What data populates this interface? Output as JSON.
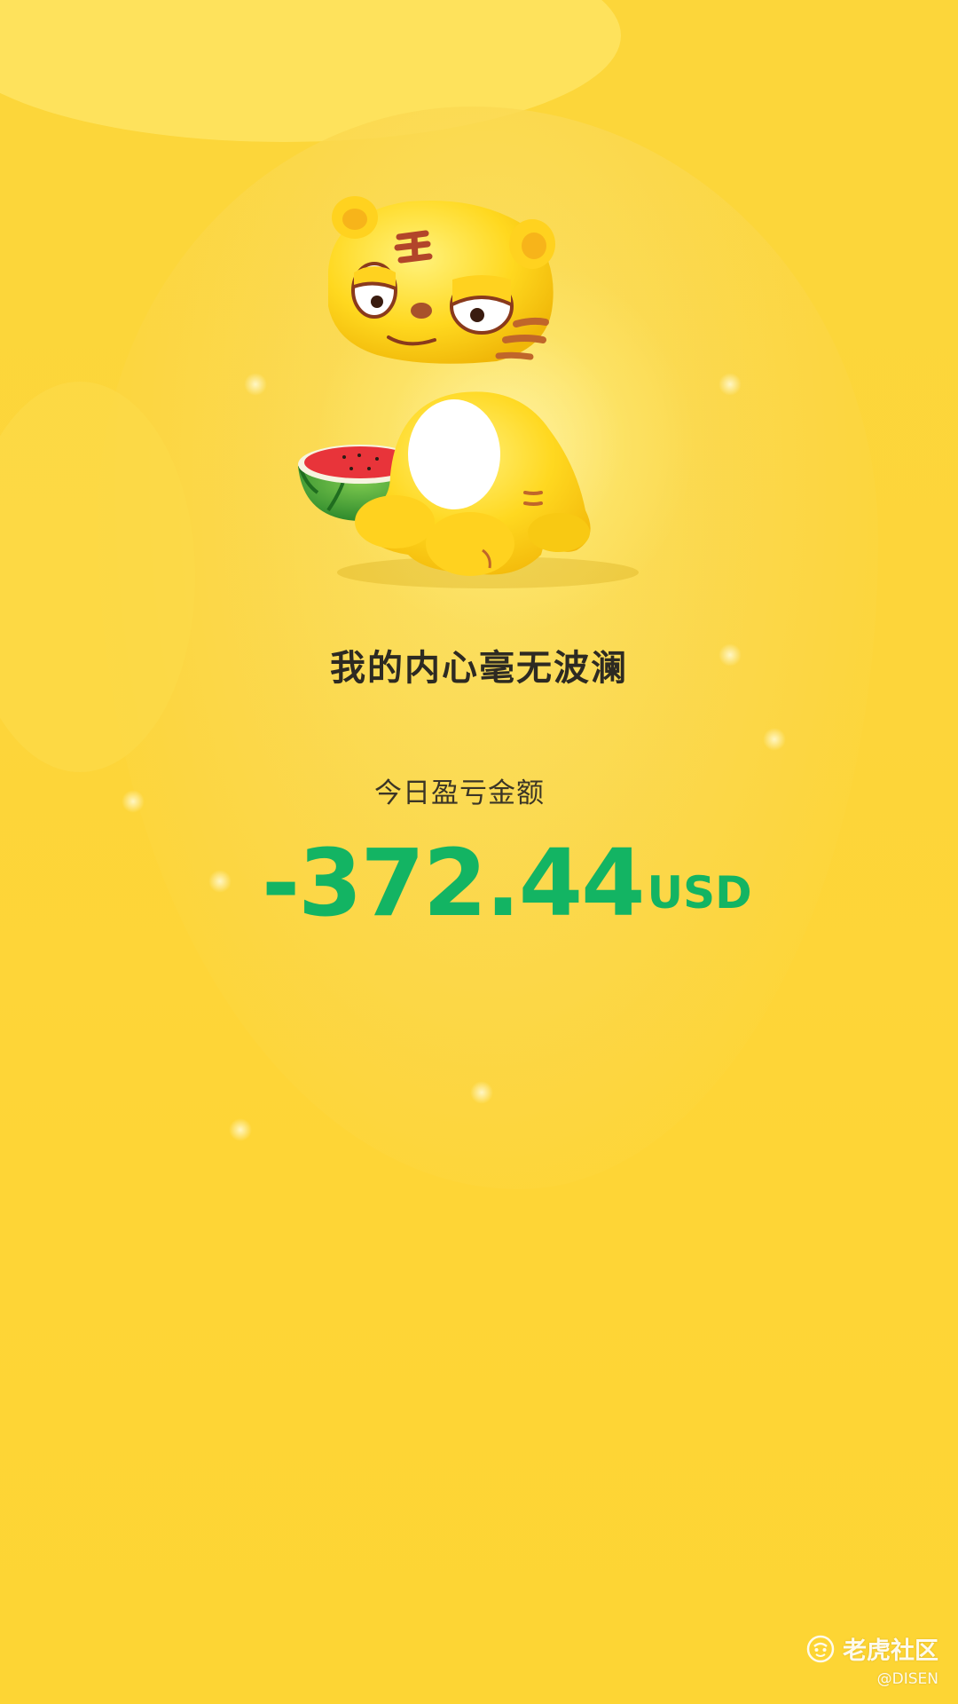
{
  "illustration": {
    "subject": "tiger-mascot-with-watermelon",
    "colors": {
      "tiger": "#ffd21f",
      "belly": "#ffffff",
      "stripes": "#c0662a",
      "watermelon_flesh": "#e8343a",
      "watermelon_rind": "#3a9c36"
    }
  },
  "headline": "我的内心毫无波澜",
  "pnl": {
    "label": "今日盈亏金额",
    "amount": "-372.44",
    "currency": "USD",
    "color": "#13b463"
  },
  "watermark": {
    "icon": "tiger-logo-icon",
    "brand": "老虎社区",
    "user": "@DISEN"
  },
  "colors": {
    "background": "#fdd53a",
    "text_dark": "#2d2a22"
  }
}
